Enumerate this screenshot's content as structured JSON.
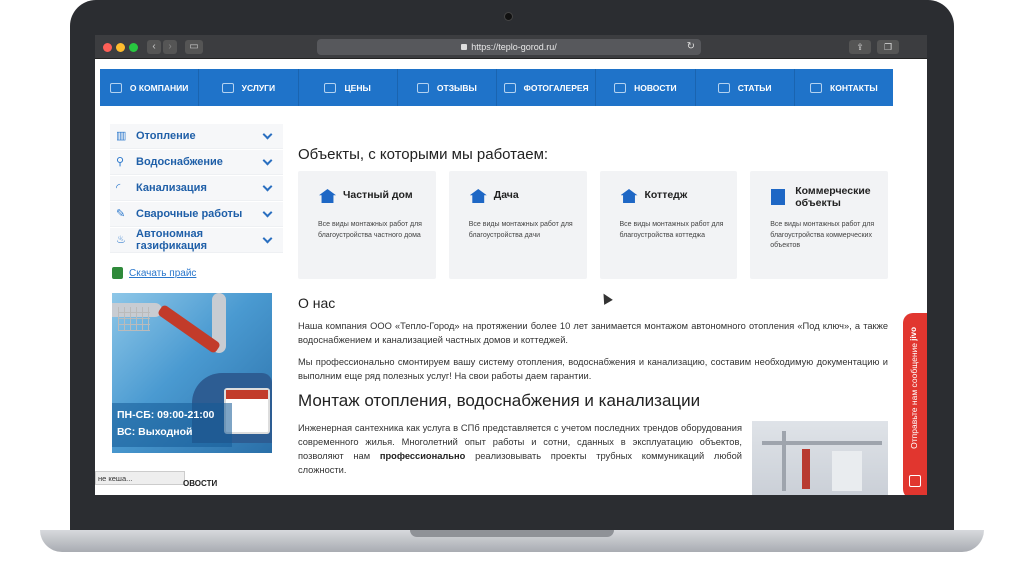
{
  "browser": {
    "url": "https://teplo-gorod.ru/"
  },
  "topnav": [
    {
      "label": "О КОМПАНИИ",
      "icon": "building-icon"
    },
    {
      "label": "УСЛУГИ",
      "icon": "tools-icon"
    },
    {
      "label": "ЦЕНЫ",
      "icon": "money-icon"
    },
    {
      "label": "ОТЗЫВЫ",
      "icon": "chat-icon"
    },
    {
      "label": "ФОТОГАЛЕРЕЯ",
      "icon": "gallery-icon"
    },
    {
      "label": "НОВОСТИ",
      "icon": "news-icon"
    },
    {
      "label": "СТАТЬИ",
      "icon": "articles-icon"
    },
    {
      "label": "КОНТАКТЫ",
      "icon": "contacts-icon"
    }
  ],
  "sidebar": {
    "items": [
      {
        "label": "Отопление",
        "icon": "radiator-icon"
      },
      {
        "label": "Водоснабжение",
        "icon": "faucet-icon"
      },
      {
        "label": "Канализация",
        "icon": "pipe-icon"
      },
      {
        "label": "Сварочные работы",
        "icon": "welding-icon"
      },
      {
        "label": "Автономная газификация",
        "icon": "flame-icon"
      }
    ],
    "price_link": "Скачать прайс",
    "promo": {
      "line1": "ПН-СБ: 09:00-21:00",
      "line2": "ВС: Выходной"
    },
    "tooltip": "не кеша...",
    "news_fragment": "ОВОСТИ"
  },
  "main": {
    "objects_heading": "Объекты, с которыми мы работаем:",
    "cards": [
      {
        "title": "Частный дом",
        "desc": "Все виды монтажных работ для благоустройства частного дома"
      },
      {
        "title": "Дача",
        "desc": "Все виды монтажных работ для благоустройства дачи"
      },
      {
        "title": "Коттедж",
        "desc": "Все виды монтажных работ для благоустройства коттеджа"
      },
      {
        "title": "Коммерческие объекты",
        "desc": "Все виды монтажных работ для благоустройства коммерческих объектов"
      }
    ],
    "about_heading": "О нас",
    "about_p1": "Наша компания ООО «Тепло-Город» на протяжении более 10 лет занимается монтажом автономного отопления «Под ключ», а также водоснабжением и канализацией частных домов и коттеджей.",
    "about_p2": "Мы профессионально смонтируем вашу систему отопления, водоснабжения и канализацию, составим необходимую документацию и выполним еще ряд полезных услуг! На свои работы даем гарантии.",
    "mount_heading": "Монтаж отопления, водоснабжения и канализации",
    "mount_text_a": "Инженерная сантехника как услуга в СПб представляется с учетом последних трендов оборудования современного жилья. Многолетний опыт работы и сотни, сданных в эксплуатацию объектов, позволяют нам ",
    "mount_text_bold": "профессионально",
    "mount_text_b": " реализовывать проекты трубных коммуникаций любой сложности."
  },
  "jivo": {
    "label": "Отправьте нам сообщение",
    "brand": "jivo"
  }
}
